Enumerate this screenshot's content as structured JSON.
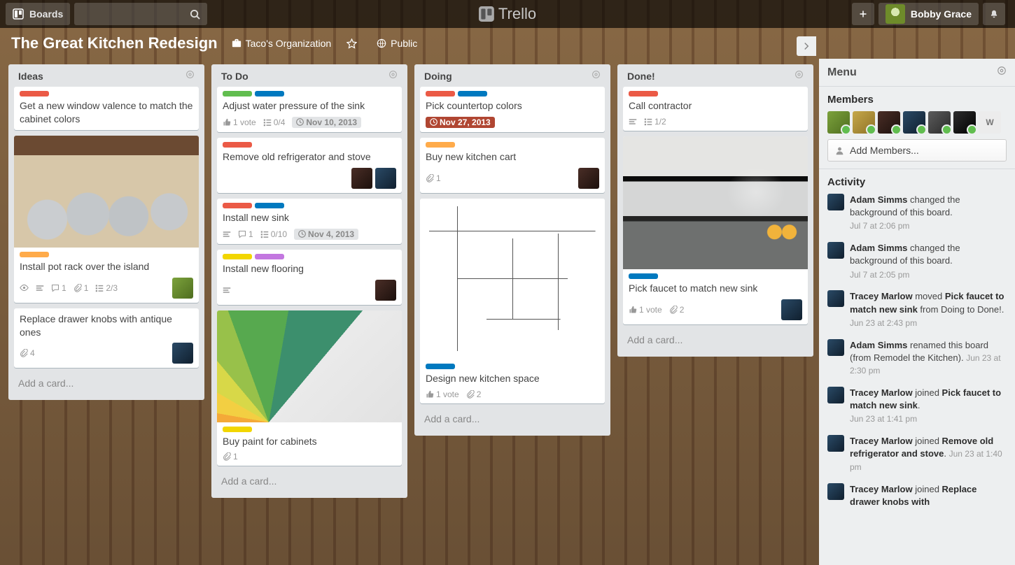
{
  "header": {
    "boards_label": "Boards",
    "logo": "Trello",
    "user_name": "Bobby Grace"
  },
  "board": {
    "title": "The Great Kitchen Redesign",
    "org": "Taco's Organization",
    "visibility": "Public"
  },
  "lists": [
    {
      "title": "Ideas",
      "add": "Add a card...",
      "cards": [
        {
          "labels": [
            "red"
          ],
          "title": "Get a new window valence to match the cabinet colors"
        },
        {
          "labels": [
            "orange"
          ],
          "cover": "cov-pots",
          "title": "Install pot rack over the island",
          "badges": {
            "watch": true,
            "desc": true,
            "comments": "1",
            "attach": "1",
            "check": "2/3"
          },
          "members": [
            "g"
          ]
        },
        {
          "title": "Replace drawer knobs with antique ones",
          "badges": {
            "attach": "4"
          },
          "members": [
            "b"
          ]
        }
      ]
    },
    {
      "title": "To Do",
      "add": "Add a card...",
      "cards": [
        {
          "labels": [
            "green",
            "blue"
          ],
          "title": "Adjust water pressure of the sink",
          "badges": {
            "votes": "1 vote",
            "check": "0/4",
            "due": "Nov 10, 2013"
          }
        },
        {
          "labels": [
            "red"
          ],
          "title": "Remove old refrigerator and stove",
          "members": [
            "d",
            "b"
          ]
        },
        {
          "labels": [
            "red",
            "blue"
          ],
          "title": "Install new sink",
          "badges": {
            "desc": true,
            "comments": "1",
            "check": "0/10",
            "due": "Nov 4, 2013"
          }
        },
        {
          "labels": [
            "yellow",
            "purple"
          ],
          "title": "Install new flooring",
          "badges": {
            "desc": true
          },
          "members": [
            "d"
          ]
        },
        {
          "labels": [
            "yellow"
          ],
          "cover": "cov-paint",
          "title": "Buy paint for cabinets",
          "badges": {
            "attach": "1"
          }
        }
      ]
    },
    {
      "title": "Doing",
      "add": "Add a card...",
      "cards": [
        {
          "labels": [
            "red",
            "blue"
          ],
          "title": "Pick countertop colors",
          "badges": {
            "due": "Nov 27, 2013",
            "due_past": true
          }
        },
        {
          "labels": [
            "orange"
          ],
          "title": "Buy new kitchen cart",
          "badges": {
            "attach": "1"
          },
          "members": [
            "d"
          ]
        },
        {
          "labels": [
            "blue"
          ],
          "cover": "cov-plan",
          "title": "Design new kitchen space",
          "badges": {
            "votes": "1 vote",
            "attach": "2"
          }
        }
      ]
    },
    {
      "title": "Done!",
      "add": "Add a card...",
      "cards": [
        {
          "labels": [
            "red"
          ],
          "title": "Call contractor",
          "badges": {
            "desc": true,
            "check": "1/2"
          }
        },
        {
          "labels": [
            "blue"
          ],
          "cover": "cov-faucet",
          "title": "Pick faucet to match new sink",
          "badges": {
            "votes": "1 vote",
            "attach": "2"
          },
          "members": [
            "b"
          ]
        }
      ]
    }
  ],
  "menu": {
    "title": "Menu",
    "members_hd": "Members",
    "add_members": "Add Members...",
    "member_initial": "W",
    "activity_hd": "Activity",
    "activity": [
      {
        "who": "Adam Simms",
        "did": " changed the background of this board.",
        "time": "Jul 7 at 2:06 pm"
      },
      {
        "who": "Adam Simms",
        "did": " changed the background of this board.",
        "time": "Jul 7 at 2:05 pm"
      },
      {
        "who": "Tracey Marlow",
        "did": " moved ",
        "obj": "Pick faucet to match new sink",
        "rest": " from Doing to Done!.",
        "time": "Jun 23 at 2:43 pm"
      },
      {
        "who": "Adam Simms",
        "did": " renamed this board (from Remodel the Kitchen).",
        "time": "Jun 23 at 2:30 pm",
        "inline_time": true
      },
      {
        "who": "Tracey Marlow",
        "did": " joined ",
        "obj": "Pick faucet to match new sink",
        "rest": ".",
        "time": "Jun 23 at 1:41 pm"
      },
      {
        "who": "Tracey Marlow",
        "did": " joined ",
        "obj": "Remove old refrigerator and stove",
        "rest": ".",
        "time": "Jun 23 at 1:40 pm",
        "inline_time": true
      },
      {
        "who": "Tracey Marlow",
        "did": " joined ",
        "obj": "Replace drawer knobs with",
        "rest": "",
        "time": ""
      }
    ]
  }
}
